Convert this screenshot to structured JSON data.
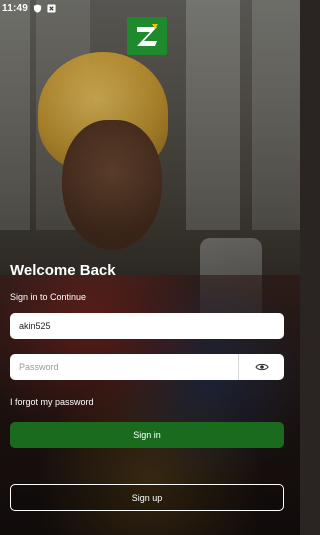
{
  "status_bar": {
    "time": "11:49",
    "icons": [
      "shield-icon",
      "notification-icon"
    ]
  },
  "brand": {
    "logo_letter": "Z",
    "logo_color": "#1e8a2d"
  },
  "login": {
    "title": "Welcome Back",
    "subtitle": "Sign in to Continue",
    "username_value": "akin525",
    "password_placeholder": "Password",
    "forgot_label": "I forgot my password",
    "signin_label": "Sign in",
    "signup_label": "Sign up"
  },
  "colors": {
    "primary_button": "#1a6b1d",
    "input_background": "#ffffff"
  }
}
